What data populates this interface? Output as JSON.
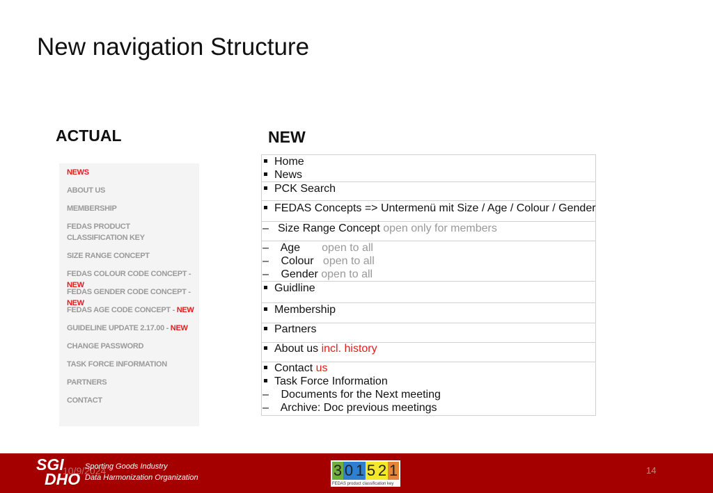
{
  "title": "New navigation Structure",
  "actual": {
    "heading": "ACTUAL",
    "items": [
      {
        "label": "NEWS",
        "new": ""
      },
      {
        "label": "ABOUT US",
        "new": ""
      },
      {
        "label": "MEMBERSHIP",
        "new": ""
      },
      {
        "label": "FEDAS PRODUCT",
        "new": ""
      },
      {
        "label": "CLASSIFICATION KEY",
        "new": ""
      },
      {
        "label": "SIZE RANGE CONCEPT",
        "new": ""
      },
      {
        "label": "FEDAS COLOUR CODE CONCEPT - ",
        "new": "NEW"
      },
      {
        "label": "FEDAS GENDER CODE CONCEPT - ",
        "new": "NEW"
      },
      {
        "label": "FEDAS AGE CODE CONCEPT - ",
        "new": "NEW"
      },
      {
        "label": "GUIDELINE UPDATE 2.17.00 - ",
        "new": "NEW"
      },
      {
        "label": "CHANGE PASSWORD",
        "new": ""
      },
      {
        "label": "TASK FORCE INFORMATION",
        "new": ""
      },
      {
        "label": "PARTNERS",
        "new": ""
      },
      {
        "label": "CONTACT",
        "new": ""
      }
    ]
  },
  "new": {
    "heading": "NEW",
    "items": [
      {
        "type": "bullet",
        "label": "Home",
        "note": ""
      },
      {
        "type": "bullet",
        "label": "News",
        "note": ""
      },
      {
        "type": "bullet",
        "label": "PCK Search",
        "note": ""
      },
      {
        "type": "bullet",
        "label": "FEDAS Concepts => Untermenü mit Size / Age / Colour / Gender",
        "note": ""
      },
      {
        "type": "dash",
        "label": "Size Range Concept",
        "note": " open only for members"
      },
      {
        "type": "dash",
        "label": " Age",
        "note": "       open to all"
      },
      {
        "type": "dash",
        "label": " Colour",
        "note": "   open to all"
      },
      {
        "type": "dash",
        "label": " Gender",
        "note": " open to all"
      },
      {
        "type": "bullet",
        "label": "Guidline",
        "note": ""
      },
      {
        "type": "bullet",
        "label": "Membership",
        "note": ""
      },
      {
        "type": "bullet",
        "label": "Partners",
        "note": ""
      },
      {
        "type": "bullet",
        "label": "About us",
        "note": " incl. history",
        "red": true
      },
      {
        "type": "bullet",
        "label": "Contact",
        "note": " us",
        "red": true
      },
      {
        "type": "bullet",
        "label": "Task Force Information",
        "note": ""
      },
      {
        "type": "dash",
        "label": " Documents for the Next meeting",
        "note": ""
      },
      {
        "type": "dash",
        "label": " Archive: Doc previous meetings",
        "note": ""
      }
    ]
  },
  "footer": {
    "sgi": "SGI",
    "dho": "DHO",
    "line1": "Sporting Goods Industry",
    "line2": "Data Harmonization Organization",
    "date": "10/9/2024",
    "page": "14",
    "logo": {
      "digits": [
        "3",
        "0",
        "1",
        "5",
        "2",
        "1"
      ],
      "colors": [
        "#6fb03a",
        "#2f7fd0",
        "#2f7fd0",
        "#f5e82a",
        "#f5e82a",
        "#e8843a"
      ],
      "caption": "FEDAS product classification key"
    }
  }
}
